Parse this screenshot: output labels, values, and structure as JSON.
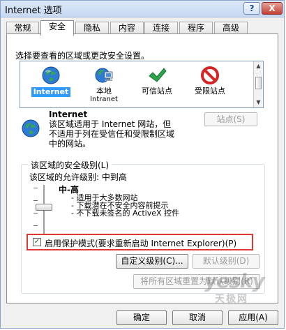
{
  "window": {
    "title": "Internet 选项",
    "help_label": "?",
    "close_label": "X"
  },
  "tabs": [
    {
      "label": "常规"
    },
    {
      "label": "安全",
      "active": true
    },
    {
      "label": "隐私"
    },
    {
      "label": "内容"
    },
    {
      "label": "连接"
    },
    {
      "label": "程序"
    },
    {
      "label": "高级"
    }
  ],
  "security": {
    "zone_prompt": "选择要查看的区域或更改安全设置。",
    "zones": [
      {
        "name": "Internet",
        "icon": "globe-icon",
        "selected": true
      },
      {
        "name": "本地",
        "subname": "Intranet",
        "icon": "local-intranet-icon"
      },
      {
        "name": "可信站点",
        "icon": "check-icon"
      },
      {
        "name": "受限站点",
        "icon": "blocked-icon"
      }
    ],
    "selected_zone": {
      "title": "Internet",
      "description": "该区域适用于 Internet 网站，但不适用于列在受信任和受限制区域中的网站。",
      "sites_button": "站点(S)"
    },
    "security_level_group": {
      "title": "该区域的安全级别(L)",
      "allowed_level": "该区域的允许级别: 中到高",
      "current_level": "中-高",
      "level_details": [
        "- 适用于大多数网站",
        "- 下载潜在不安全内容前提示",
        "- 不下载未签名的 ActiveX 控件"
      ],
      "protected_mode_label": "启用保护模式(要求重新启动 Internet Explorer)(P)",
      "protected_mode_checked": true,
      "custom_level_button": "自定义级别(C)...",
      "default_level_button": "默认级别(D)",
      "reset_all_button": "将所有区域重置为默认级别(R)"
    }
  },
  "footer": {
    "ok_button": "确定",
    "cancel_button": "取消",
    "apply_button": "应用(A)"
  },
  "watermark": {
    "main": "yesky",
    "sub": "天极网"
  },
  "colors": {
    "selection": "#3399ff",
    "highlight_border": "#e03636",
    "window_border": "#8aa2c9"
  }
}
